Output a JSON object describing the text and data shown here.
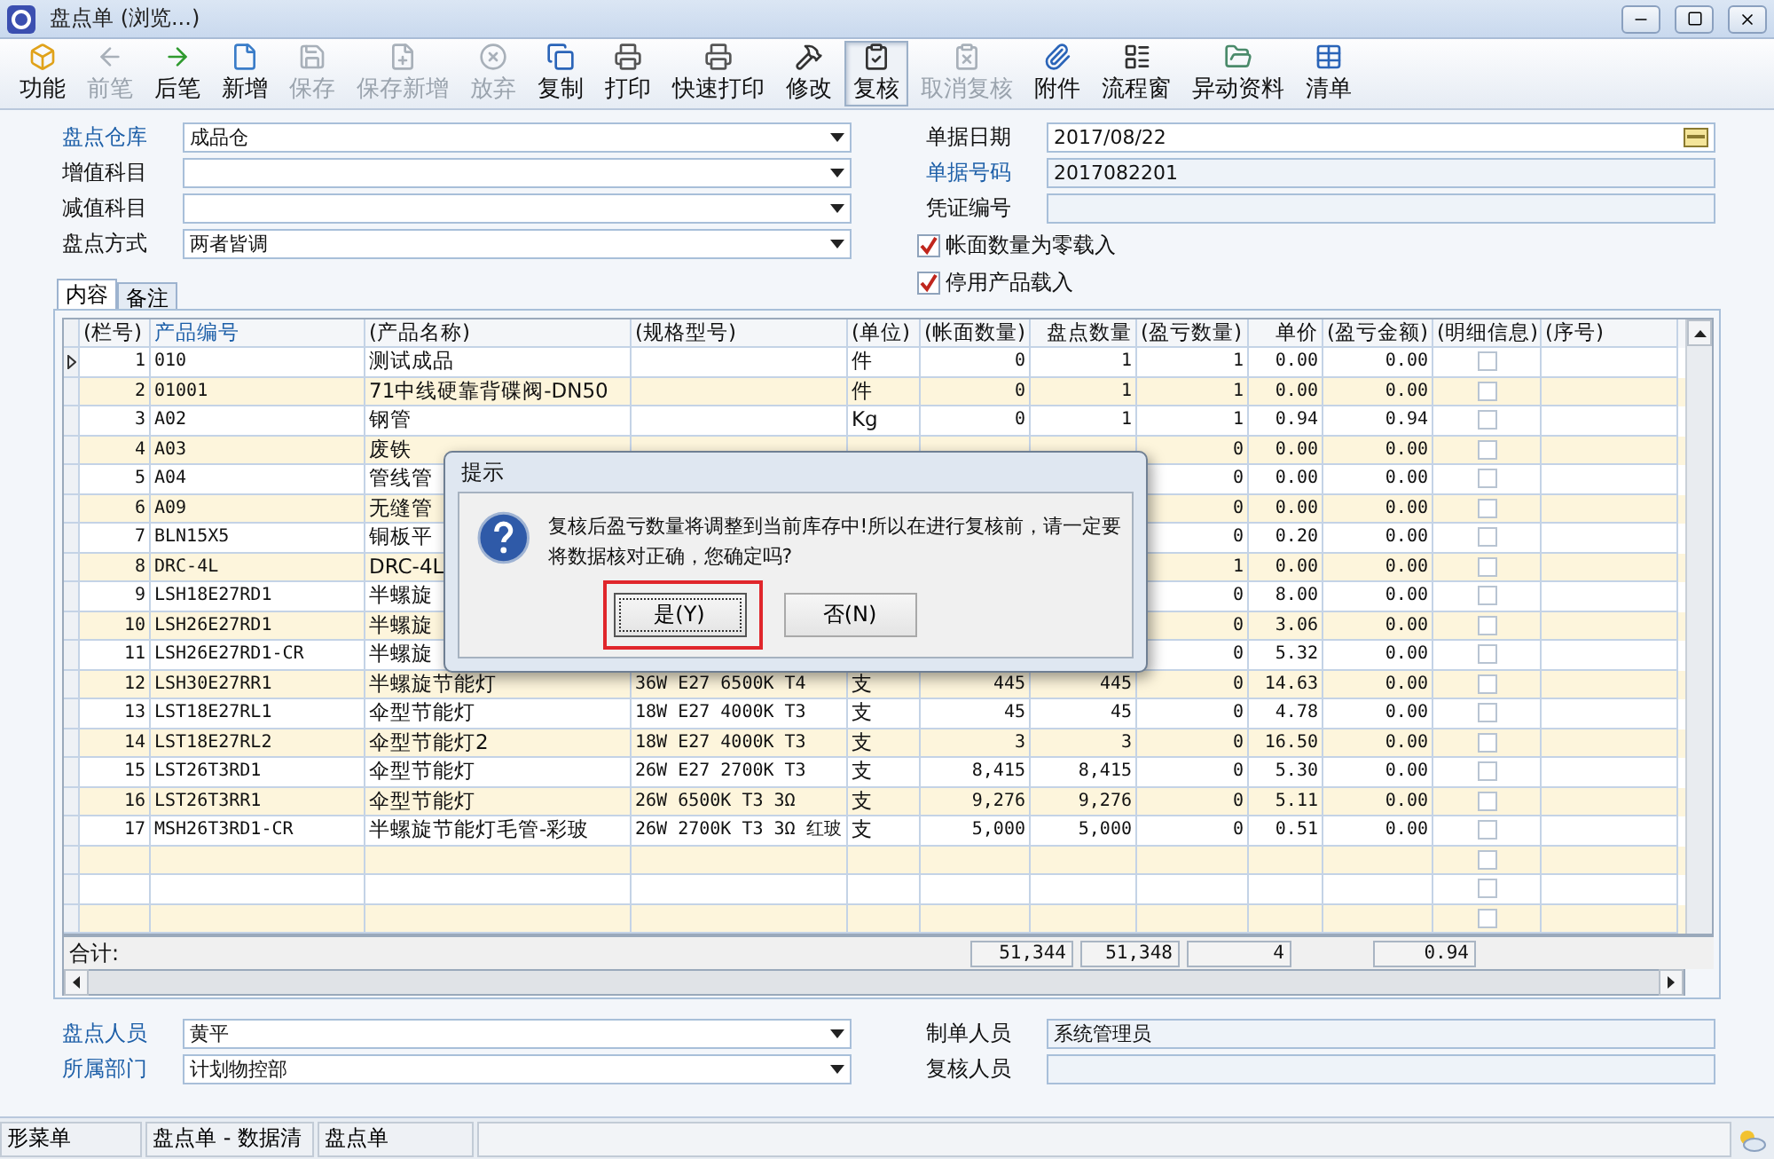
{
  "window": {
    "title": "盘点单 (浏览...)"
  },
  "toolbar": [
    {
      "label": "功能",
      "disabled": false,
      "selected": false
    },
    {
      "label": "前笔",
      "disabled": true,
      "selected": false
    },
    {
      "label": "后笔",
      "disabled": false,
      "selected": false
    },
    {
      "label": "新增",
      "disabled": false,
      "selected": false
    },
    {
      "label": "保存",
      "disabled": true,
      "selected": false
    },
    {
      "label": "保存新增",
      "disabled": true,
      "selected": false
    },
    {
      "label": "放弃",
      "disabled": true,
      "selected": false
    },
    {
      "label": "复制",
      "disabled": false,
      "selected": false
    },
    {
      "label": "打印",
      "disabled": false,
      "selected": false
    },
    {
      "label": "快速打印",
      "disabled": false,
      "selected": false
    },
    {
      "label": "修改",
      "disabled": false,
      "selected": false
    },
    {
      "label": "复核",
      "disabled": false,
      "selected": true
    },
    {
      "label": "取消复核",
      "disabled": true,
      "selected": false
    },
    {
      "label": "附件",
      "disabled": false,
      "selected": false
    },
    {
      "label": "流程窗",
      "disabled": false,
      "selected": false
    },
    {
      "label": "异动资料",
      "disabled": false,
      "selected": false
    },
    {
      "label": "清单",
      "disabled": false,
      "selected": false
    }
  ],
  "header_form": {
    "left": [
      {
        "label": "盘点仓库",
        "accent": true,
        "kind": "dropdown",
        "value": "成品仓"
      },
      {
        "label": "增值科目",
        "accent": false,
        "kind": "dropdown"
      },
      {
        "label": "减值科目",
        "accent": false,
        "kind": "dropdown"
      },
      {
        "label": "盘点方式",
        "accent": false,
        "kind": "dropdown",
        "value": "两者皆调"
      }
    ],
    "right": [
      {
        "label": "单据日期",
        "accent": false,
        "kind": "date",
        "value": "2017/08/22"
      },
      {
        "label": "单据号码",
        "accent": true,
        "kind": "text",
        "value": "2017082201"
      },
      {
        "label": "凭证编号",
        "accent": false,
        "kind": "text"
      }
    ],
    "options": [
      {
        "label": "帐面数量为零载入",
        "checked": true
      },
      {
        "label": "停用产品载入",
        "checked": true
      }
    ]
  },
  "tabs": [
    {
      "label": "内容",
      "selected": true
    },
    {
      "label": "备注",
      "selected": false
    }
  ],
  "table": {
    "columns": [
      {
        "label": "(栏号)",
        "accent": false
      },
      {
        "label": "产品编号",
        "accent": true
      },
      {
        "label": "(产品名称)",
        "accent": false
      },
      {
        "label": "(规格型号)",
        "accent": false
      },
      {
        "label": "(单位)",
        "accent": false
      },
      {
        "label": "(帐面数量)",
        "accent": false
      },
      {
        "label": "盘点数量",
        "accent": false
      },
      {
        "label": "(盈亏数量)",
        "accent": false
      },
      {
        "label": "单价",
        "accent": false
      },
      {
        "label": "(盈亏金额)",
        "accent": false
      },
      {
        "label": "(明细信息)",
        "accent": false
      },
      {
        "label": "(序号)",
        "accent": false
      }
    ],
    "rows": [
      {
        "selected": true,
        "no": "1",
        "code": "010",
        "name": "测试成品",
        "unit": "件",
        "book": "0",
        "count": "1",
        "diff": "1",
        "price": "0.00",
        "amount": "0.00",
        "detail_checked": false
      },
      {
        "selected": false,
        "no": "2",
        "code": "01001",
        "name": "71中线硬靠背碟阀-DN50",
        "unit": "件",
        "book": "0",
        "count": "1",
        "diff": "1",
        "price": "0.00",
        "amount": "0.00",
        "detail_checked": false
      },
      {
        "selected": false,
        "no": "3",
        "code": "A02",
        "name": "钢管",
        "unit": "Kg",
        "book": "0",
        "count": "1",
        "diff": "1",
        "price": "0.94",
        "amount": "0.94",
        "detail_checked": false
      },
      {
        "selected": false,
        "no": "4",
        "code": "A03",
        "name": "废铁",
        "diff": "0",
        "price": "0.00",
        "amount": "0.00",
        "detail_checked": false
      },
      {
        "selected": false,
        "no": "5",
        "code": "A04",
        "name": "管线管",
        "diff": "0",
        "price": "0.00",
        "amount": "0.00",
        "detail_checked": false
      },
      {
        "selected": false,
        "no": "6",
        "code": "A09",
        "name": "无缝管",
        "diff": "0",
        "price": "0.00",
        "amount": "0.00",
        "detail_checked": false
      },
      {
        "selected": false,
        "no": "7",
        "code": "BLN15X5",
        "name": "铜板平",
        "diff": "0",
        "price": "0.20",
        "amount": "0.00",
        "detail_checked": false
      },
      {
        "selected": false,
        "no": "8",
        "code": "DRC-4L",
        "name": "DRC-4L",
        "diff": "1",
        "price": "0.00",
        "amount": "0.00",
        "detail_checked": false
      },
      {
        "selected": false,
        "no": "9",
        "code": "LSH18E27RD1",
        "name": "半螺旋",
        "diff": "0",
        "price": "8.00",
        "amount": "0.00",
        "detail_checked": false
      },
      {
        "selected": false,
        "no": "10",
        "code": "LSH26E27RD1",
        "name": "半螺旋",
        "diff": "0",
        "price": "3.06",
        "amount": "0.00",
        "detail_checked": false
      },
      {
        "selected": false,
        "no": "11",
        "code": "LSH26E27RD1-CR",
        "name": "半螺旋",
        "diff": "0",
        "price": "5.32",
        "amount": "0.00",
        "detail_checked": false
      },
      {
        "selected": false,
        "no": "12",
        "code": "LSH30E27RR1",
        "name": "半螺旋节能灯",
        "spec": "36W E27 6500K T4",
        "unit": "支",
        "book": "445",
        "count": "445",
        "diff": "0",
        "price": "14.63",
        "amount": "0.00",
        "detail_checked": false
      },
      {
        "selected": false,
        "no": "13",
        "code": "LST18E27RL1",
        "name": "伞型节能灯",
        "spec": "18W E27 4000K T3",
        "unit": "支",
        "book": "45",
        "count": "45",
        "diff": "0",
        "price": "4.78",
        "amount": "0.00",
        "detail_checked": false
      },
      {
        "selected": false,
        "no": "14",
        "code": "LST18E27RL2",
        "name": "伞型节能灯2",
        "spec": "18W E27 4000K T3",
        "unit": "支",
        "book": "3",
        "count": "3",
        "diff": "0",
        "price": "16.50",
        "amount": "0.00",
        "detail_checked": false
      },
      {
        "selected": false,
        "no": "15",
        "code": "LST26T3RD1",
        "name": "伞型节能灯",
        "spec": "26W E27 2700K T3",
        "unit": "支",
        "book": "8,415",
        "count": "8,415",
        "diff": "0",
        "price": "5.30",
        "amount": "0.00",
        "detail_checked": false
      },
      {
        "selected": false,
        "no": "16",
        "code": "LST26T3RR1",
        "name": "伞型节能灯",
        "spec": "26W 6500K T3 3Ω",
        "unit": "支",
        "book": "9,276",
        "count": "9,276",
        "diff": "0",
        "price": "5.11",
        "amount": "0.00",
        "detail_checked": false
      },
      {
        "selected": false,
        "no": "17",
        "code": "MSH26T3RD1-CR",
        "name": "半螺旋节能灯毛管-彩玻",
        "spec": "26W 2700K T3 3Ω 红玻",
        "unit": "支",
        "book": "5,000",
        "count": "5,000",
        "diff": "0",
        "price": "0.51",
        "amount": "0.00",
        "detail_checked": false
      },
      {
        "selected": false,
        "detail_checked": false
      },
      {
        "selected": false,
        "detail_checked": false
      },
      {
        "selected": false,
        "detail_checked": false
      }
    ],
    "totals": {
      "label": "合计:",
      "book": "51,344",
      "count": "51,348",
      "diff": "4",
      "amount": "0.94"
    }
  },
  "footer_form": {
    "left": [
      {
        "label": "盘点人员",
        "accent": true,
        "kind": "dropdown",
        "value": "黄平"
      },
      {
        "label": "所属部门",
        "accent": true,
        "kind": "dropdown",
        "value": "计划物控部"
      }
    ],
    "right": [
      {
        "label": "制单人员",
        "accent": false,
        "kind": "text",
        "value": "系统管理员"
      },
      {
        "label": "复核人员",
        "accent": false,
        "kind": "text"
      }
    ]
  },
  "dialog": {
    "title": "提示",
    "message": "复核后盈亏数量将调整到当前库存中!所以在进行复核前，请一定要将数据核对正确，您确定吗?",
    "buttons": [
      {
        "label": "是(Y)",
        "focused": true,
        "highlighted": true
      },
      {
        "label": "否(N)",
        "focused": false,
        "highlighted": false
      }
    ]
  },
  "status_bar": {
    "tabs": [
      {
        "label": "形菜单"
      },
      {
        "label": "盘点单 - 数据清"
      },
      {
        "label": "盘点单"
      }
    ]
  }
}
